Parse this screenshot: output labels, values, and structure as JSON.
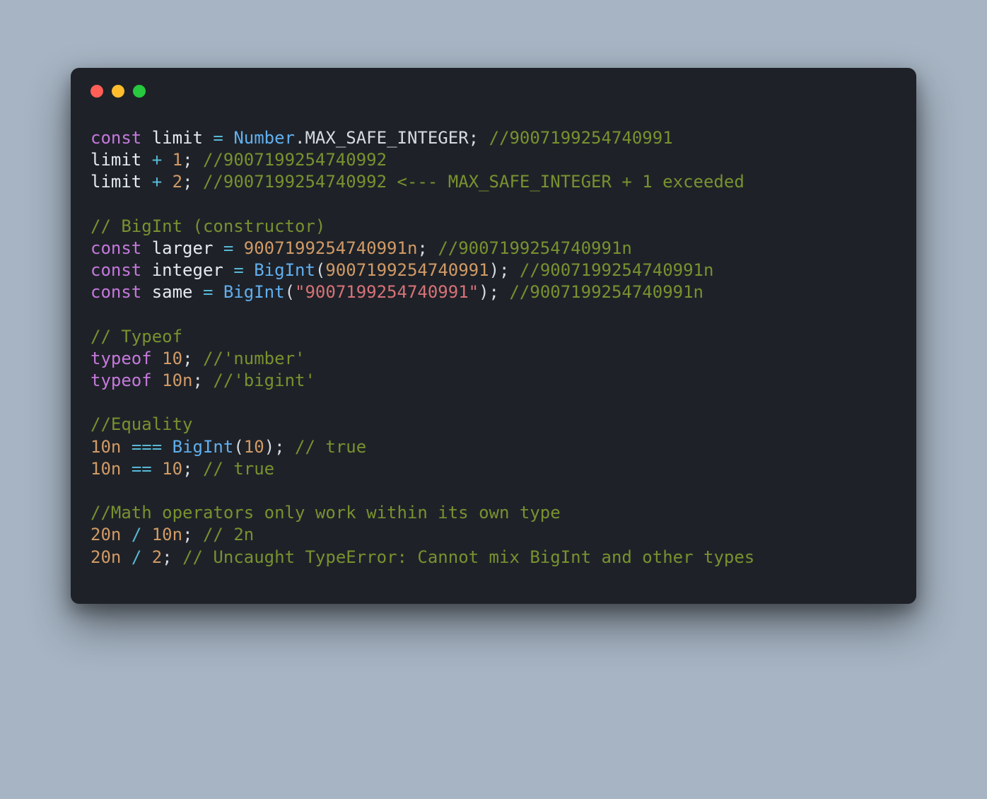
{
  "colors": {
    "bg": "#a6b4c3",
    "window": "#1e2228",
    "dots": {
      "red": "#ff5f56",
      "yellow": "#ffbd2e",
      "green": "#27c93f"
    },
    "keyword": "#c678dd",
    "variable": "#e5eaf0",
    "operator": "#58b9d7",
    "type": "#61afef",
    "number": "#d19a66",
    "string": "#d77277",
    "comment": "#79912f"
  },
  "code": {
    "lines": [
      [
        {
          "t": "kw",
          "v": "const"
        },
        {
          "t": "sp",
          "v": " "
        },
        {
          "t": "var",
          "v": "limit"
        },
        {
          "t": "sp",
          "v": " "
        },
        {
          "t": "op",
          "v": "="
        },
        {
          "t": "sp",
          "v": " "
        },
        {
          "t": "type",
          "v": "Number"
        },
        {
          "t": "punc",
          "v": "."
        },
        {
          "t": "prop",
          "v": "MAX_SAFE_INTEGER"
        },
        {
          "t": "punc",
          "v": ";"
        },
        {
          "t": "sp",
          "v": " "
        },
        {
          "t": "comment",
          "v": "//9007199254740991"
        }
      ],
      [
        {
          "t": "var",
          "v": "limit"
        },
        {
          "t": "sp",
          "v": " "
        },
        {
          "t": "op",
          "v": "+"
        },
        {
          "t": "sp",
          "v": " "
        },
        {
          "t": "num",
          "v": "1"
        },
        {
          "t": "punc",
          "v": ";"
        },
        {
          "t": "sp",
          "v": " "
        },
        {
          "t": "comment",
          "v": "//9007199254740992"
        }
      ],
      [
        {
          "t": "var",
          "v": "limit"
        },
        {
          "t": "sp",
          "v": " "
        },
        {
          "t": "op",
          "v": "+"
        },
        {
          "t": "sp",
          "v": " "
        },
        {
          "t": "num",
          "v": "2"
        },
        {
          "t": "punc",
          "v": ";"
        },
        {
          "t": "sp",
          "v": " "
        },
        {
          "t": "comment",
          "v": "//9007199254740992 <--- MAX_SAFE_INTEGER + 1 exceeded"
        }
      ],
      [],
      [
        {
          "t": "comment",
          "v": "// BigInt (constructor)"
        }
      ],
      [
        {
          "t": "kw",
          "v": "const"
        },
        {
          "t": "sp",
          "v": " "
        },
        {
          "t": "var",
          "v": "larger"
        },
        {
          "t": "sp",
          "v": " "
        },
        {
          "t": "op",
          "v": "="
        },
        {
          "t": "sp",
          "v": " "
        },
        {
          "t": "num",
          "v": "9007199254740991n"
        },
        {
          "t": "punc",
          "v": ";"
        },
        {
          "t": "sp",
          "v": " "
        },
        {
          "t": "comment",
          "v": "//9007199254740991n"
        }
      ],
      [
        {
          "t": "kw",
          "v": "const"
        },
        {
          "t": "sp",
          "v": " "
        },
        {
          "t": "var",
          "v": "integer"
        },
        {
          "t": "sp",
          "v": " "
        },
        {
          "t": "op",
          "v": "="
        },
        {
          "t": "sp",
          "v": " "
        },
        {
          "t": "type",
          "v": "BigInt"
        },
        {
          "t": "punc",
          "v": "("
        },
        {
          "t": "num",
          "v": "9007199254740991"
        },
        {
          "t": "punc",
          "v": ");"
        },
        {
          "t": "sp",
          "v": " "
        },
        {
          "t": "comment",
          "v": "//9007199254740991n"
        }
      ],
      [
        {
          "t": "kw",
          "v": "const"
        },
        {
          "t": "sp",
          "v": " "
        },
        {
          "t": "var",
          "v": "same"
        },
        {
          "t": "sp",
          "v": " "
        },
        {
          "t": "op",
          "v": "="
        },
        {
          "t": "sp",
          "v": " "
        },
        {
          "t": "type",
          "v": "BigInt"
        },
        {
          "t": "punc",
          "v": "("
        },
        {
          "t": "str",
          "v": "\"9007199254740991\""
        },
        {
          "t": "punc",
          "v": ");"
        },
        {
          "t": "sp",
          "v": " "
        },
        {
          "t": "comment",
          "v": "//9007199254740991n"
        }
      ],
      [],
      [
        {
          "t": "comment",
          "v": "// Typeof"
        }
      ],
      [
        {
          "t": "kw",
          "v": "typeof"
        },
        {
          "t": "sp",
          "v": " "
        },
        {
          "t": "num",
          "v": "10"
        },
        {
          "t": "punc",
          "v": ";"
        },
        {
          "t": "sp",
          "v": " "
        },
        {
          "t": "comment",
          "v": "//'number'"
        }
      ],
      [
        {
          "t": "kw",
          "v": "typeof"
        },
        {
          "t": "sp",
          "v": " "
        },
        {
          "t": "num",
          "v": "10n"
        },
        {
          "t": "punc",
          "v": ";"
        },
        {
          "t": "sp",
          "v": " "
        },
        {
          "t": "comment",
          "v": "//'bigint'"
        }
      ],
      [],
      [
        {
          "t": "comment",
          "v": "//Equality"
        }
      ],
      [
        {
          "t": "num",
          "v": "10n"
        },
        {
          "t": "sp",
          "v": " "
        },
        {
          "t": "op",
          "v": "==="
        },
        {
          "t": "sp",
          "v": " "
        },
        {
          "t": "type",
          "v": "BigInt"
        },
        {
          "t": "punc",
          "v": "("
        },
        {
          "t": "num",
          "v": "10"
        },
        {
          "t": "punc",
          "v": ");"
        },
        {
          "t": "sp",
          "v": " "
        },
        {
          "t": "comment",
          "v": "// true"
        }
      ],
      [
        {
          "t": "num",
          "v": "10n"
        },
        {
          "t": "sp",
          "v": " "
        },
        {
          "t": "op",
          "v": "=="
        },
        {
          "t": "sp",
          "v": " "
        },
        {
          "t": "num",
          "v": "10"
        },
        {
          "t": "punc",
          "v": ";"
        },
        {
          "t": "sp",
          "v": " "
        },
        {
          "t": "comment",
          "v": "// true"
        }
      ],
      [],
      [
        {
          "t": "comment",
          "v": "//Math operators only work within its own type"
        }
      ],
      [
        {
          "t": "num",
          "v": "20n"
        },
        {
          "t": "sp",
          "v": " "
        },
        {
          "t": "op",
          "v": "/"
        },
        {
          "t": "sp",
          "v": " "
        },
        {
          "t": "num",
          "v": "10n"
        },
        {
          "t": "punc",
          "v": ";"
        },
        {
          "t": "sp",
          "v": " "
        },
        {
          "t": "comment",
          "v": "// 2n"
        }
      ],
      [
        {
          "t": "num",
          "v": "20n"
        },
        {
          "t": "sp",
          "v": " "
        },
        {
          "t": "op",
          "v": "/"
        },
        {
          "t": "sp",
          "v": " "
        },
        {
          "t": "num",
          "v": "2"
        },
        {
          "t": "punc",
          "v": ";"
        },
        {
          "t": "sp",
          "v": " "
        },
        {
          "t": "comment",
          "v": "// Uncaught TypeError: Cannot mix BigInt and other types"
        }
      ]
    ]
  }
}
